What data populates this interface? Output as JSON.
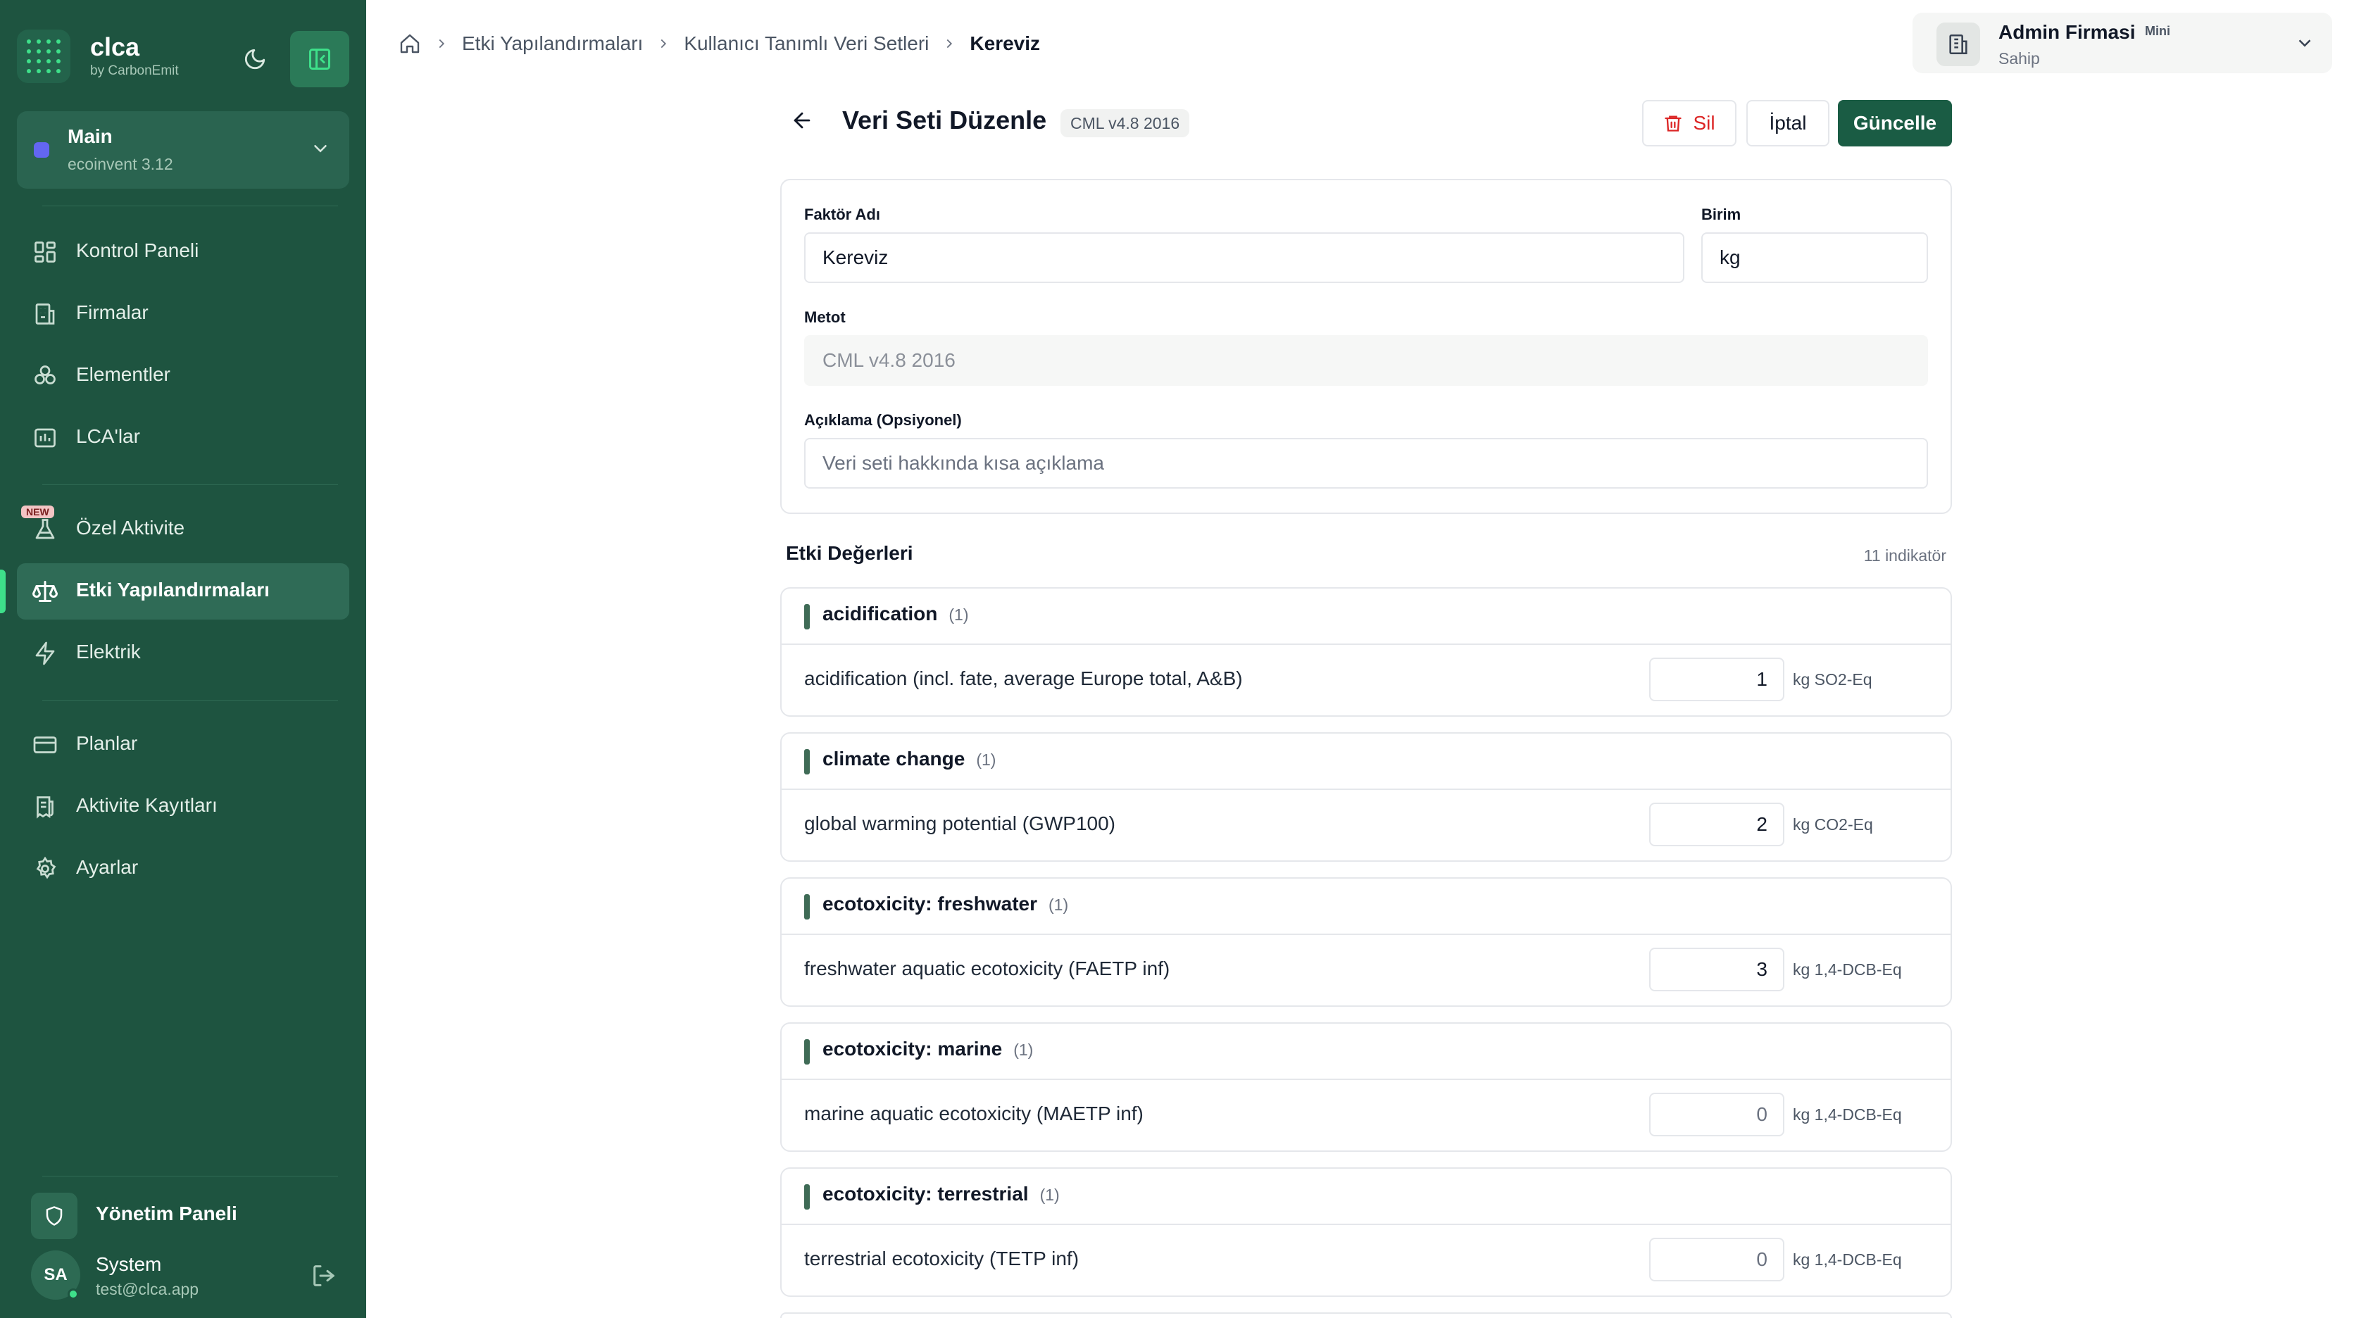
{
  "brand": {
    "name": "clca",
    "sub": "by CarbonEmit"
  },
  "workspace": {
    "name": "Main",
    "database": "ecoinvent 3.12"
  },
  "nav": [
    {
      "label": "Kontrol Paneli",
      "icon": "dashboard-icon"
    },
    {
      "label": "Firmalar",
      "icon": "building-icon"
    },
    {
      "label": "Elementler",
      "icon": "elements-icon"
    },
    {
      "label": "LCA'lar",
      "icon": "chart-icon"
    },
    {
      "label": "Özel Aktivite",
      "icon": "flask-icon",
      "badge": "NEW"
    },
    {
      "label": "Etki Yapılandırmaları",
      "icon": "scale-icon",
      "active": true
    },
    {
      "label": "Elektrik",
      "icon": "bolt-icon"
    },
    {
      "label": "Planlar",
      "icon": "card-icon"
    },
    {
      "label": "Aktivite Kayıtları",
      "icon": "receipt-icon"
    },
    {
      "label": "Ayarlar",
      "icon": "gear-icon"
    }
  ],
  "admin_panel": {
    "label": "Yönetim Paneli"
  },
  "user": {
    "initials": "SA",
    "name": "System",
    "email": "test@clca.app"
  },
  "breadcrumb": {
    "items": [
      "Etki Yapılandırmaları",
      "Kullanıcı Tanımlı Veri Setleri"
    ],
    "current": "Kereviz"
  },
  "company": {
    "name": "Admin Firmasi",
    "plan": "Mini",
    "role": "Sahip"
  },
  "header": {
    "title": "Veri Seti Düzenle",
    "method_badge": "CML v4.8 2016",
    "delete_label": "Sil",
    "cancel_label": "İptal",
    "update_label": "Güncelle"
  },
  "form": {
    "factor_label": "Faktör Adı",
    "factor_value": "Kereviz",
    "unit_label": "Birim",
    "unit_value": "kg",
    "method_label": "Metot",
    "method_value": "CML v4.8 2016",
    "desc_label": "Açıklama (Opsiyonel)",
    "desc_placeholder": "Veri seti hakkında kısa açıklama"
  },
  "impact": {
    "title": "Etki Değerleri",
    "count": "11 indikatör",
    "groups": [
      {
        "name": "acidification",
        "count": "(1)",
        "indicator": "acidification (incl. fate, average Europe total, A&B)",
        "value": "1",
        "unit": "kg SO2-Eq"
      },
      {
        "name": "climate change",
        "count": "(1)",
        "indicator": "global warming potential (GWP100)",
        "value": "2",
        "unit": "kg CO2-Eq"
      },
      {
        "name": "ecotoxicity: freshwater",
        "count": "(1)",
        "indicator": "freshwater aquatic ecotoxicity (FAETP inf)",
        "value": "3",
        "unit": "kg 1,4-DCB-Eq"
      },
      {
        "name": "ecotoxicity: marine",
        "count": "(1)",
        "indicator": "marine aquatic ecotoxicity (MAETP inf)",
        "value": "0",
        "unit": "kg 1,4-DCB-Eq"
      },
      {
        "name": "ecotoxicity: terrestrial",
        "count": "(1)",
        "indicator": "terrestrial ecotoxicity (TETP inf)",
        "value": "0",
        "unit": "kg 1,4-DCB-Eq"
      }
    ]
  },
  "colors": {
    "sidebar": "#1e5440",
    "accent": "#3ee08a",
    "primary_button": "#1a5c44",
    "danger": "#dc2626"
  }
}
